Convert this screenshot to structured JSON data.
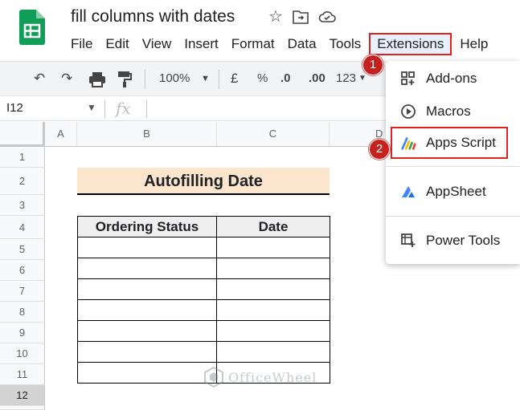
{
  "doc": {
    "title": "fill columns with dates"
  },
  "menu": [
    "File",
    "Edit",
    "View",
    "Insert",
    "Format",
    "Data",
    "Tools",
    "Extensions",
    "Help"
  ],
  "steps": {
    "one": "1",
    "two": "2"
  },
  "toolbar": {
    "zoom": "100%",
    "currency": "£",
    "percent": "%",
    "dec_less": ".0",
    "dec_more": ".00",
    "format": "123"
  },
  "formula_bar": {
    "cell_ref": "I12",
    "fx": "fx"
  },
  "columns": [
    "A",
    "B",
    "C",
    "D"
  ],
  "rows": [
    "1",
    "2",
    "3",
    "4",
    "5",
    "6",
    "7",
    "8",
    "9",
    "10",
    "11",
    "12"
  ],
  "sheet": {
    "heading": "Autofilling Date",
    "table_headers": [
      "Ordering Status",
      "Date"
    ]
  },
  "extensions_menu": {
    "items": [
      "Add-ons",
      "Macros",
      "Apps Script",
      "AppSheet",
      "Power Tools"
    ]
  },
  "watermark": "OfficeWheel",
  "colors": {
    "accent_red": "#e0201c",
    "heading_fill": "#fce5cd",
    "sheets_green": "#0f9d58"
  }
}
